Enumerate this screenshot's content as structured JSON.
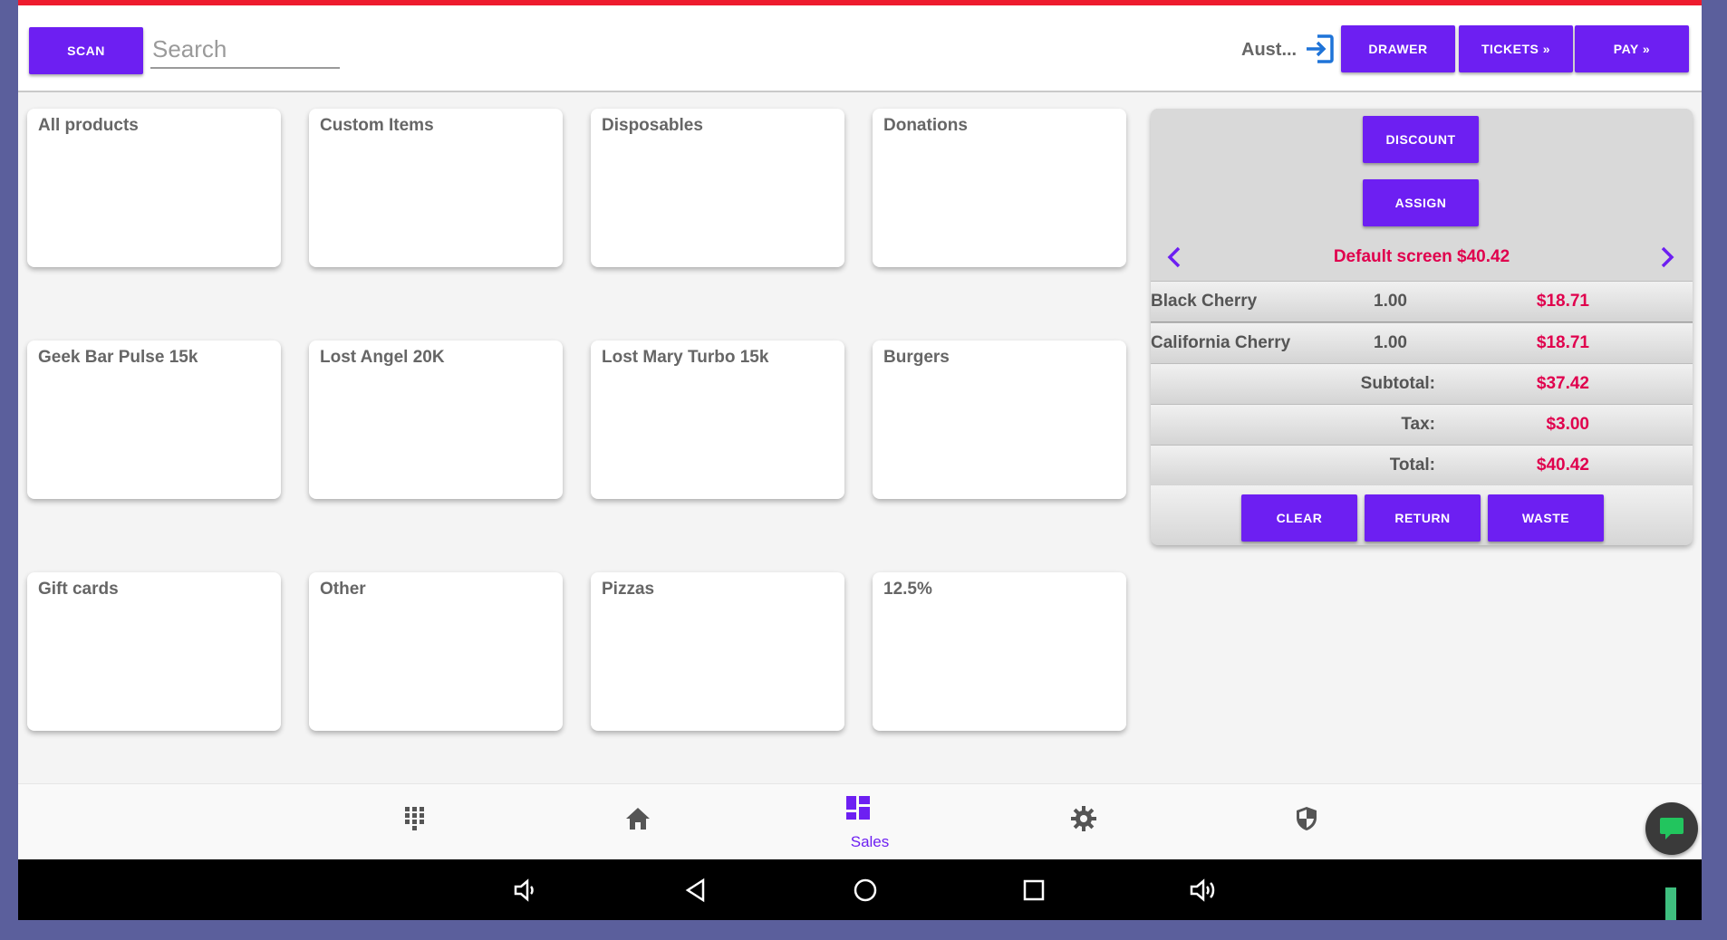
{
  "header": {
    "scan_label": "SCAN",
    "search_placeholder": "Search",
    "user_label": "Aust...",
    "drawer_label": "DRAWER",
    "tickets_label": "TICKETS »",
    "pay_label": "PAY »"
  },
  "categories": [
    {
      "label": "All products"
    },
    {
      "label": "Custom Items"
    },
    {
      "label": "Disposables"
    },
    {
      "label": "Donations"
    },
    {
      "label": "Geek Bar Pulse 15k"
    },
    {
      "label": "Lost Angel 20K"
    },
    {
      "label": "Lost Mary Turbo 15k"
    },
    {
      "label": "Burgers"
    },
    {
      "label": "Gift cards"
    },
    {
      "label": "Other"
    },
    {
      "label": "Pizzas"
    },
    {
      "label": "12.5%"
    }
  ],
  "cart": {
    "discount_label": "DISCOUNT",
    "assign_label": "ASSIGN",
    "screen_title": "Default screen $40.42",
    "items": [
      {
        "name": "Black Cherry",
        "qty": "1.00",
        "price": "$18.71"
      },
      {
        "name": "California Cherry",
        "qty": "1.00",
        "price": "$18.71"
      }
    ],
    "subtotal_label": "Subtotal:",
    "subtotal_value": "$37.42",
    "tax_label": "Tax:",
    "tax_value": "$3.00",
    "total_label": "Total:",
    "total_value": "$40.42",
    "clear_label": "CLEAR",
    "return_label": "RETURN",
    "waste_label": "WASTE"
  },
  "bottom_nav": {
    "items": [
      {
        "icon": "keypad-icon"
      },
      {
        "icon": "home-icon"
      },
      {
        "icon": "dashboard-icon",
        "label": "Sales",
        "active": true
      },
      {
        "icon": "gear-icon"
      },
      {
        "icon": "shield-icon"
      }
    ]
  },
  "colors": {
    "accent": "#6d1ff2",
    "price": "#e0004d",
    "top_strip": "#ee1b2e"
  }
}
